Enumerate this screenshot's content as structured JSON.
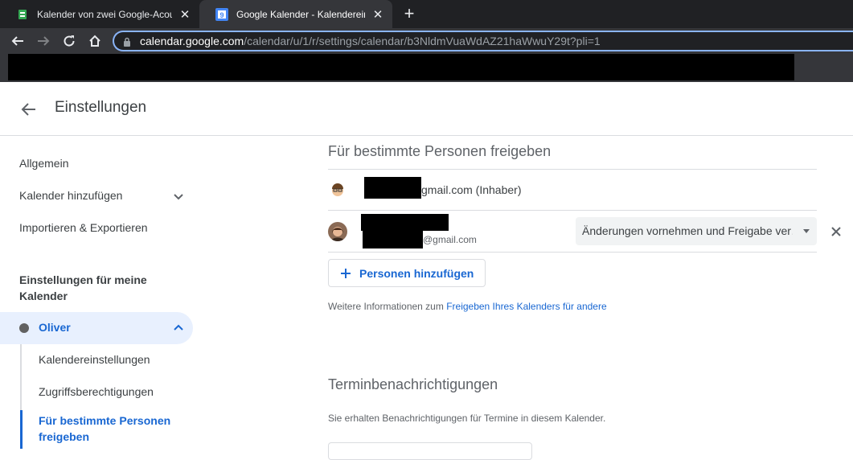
{
  "browser": {
    "tabs": [
      {
        "title": "Kalender von zwei Google-Acoun",
        "active": false,
        "favicon": "green-calendar-favicon"
      },
      {
        "title": "Google Kalender - Kalendereinste",
        "active": true,
        "favicon": "google-calendar-favicon"
      }
    ],
    "url_host": "calendar.google.com",
    "url_path": "/calendar/u/1/r/settings/calendar/b3NldmVuaWdAZ21haWwuY29t?pli=1"
  },
  "header": {
    "title": "Einstellungen"
  },
  "sidebar": {
    "items": [
      {
        "label": "Allgemein"
      },
      {
        "label": "Kalender hinzufügen"
      },
      {
        "label": "Importieren & Exportieren"
      }
    ],
    "section_label": "Einstellungen für meine Kalender",
    "calendar": {
      "name": "Oliver",
      "color": "#616161"
    },
    "sub_items": [
      {
        "label": "Kalendereinstellungen"
      },
      {
        "label": "Zugriffsberechtigungen"
      },
      {
        "label": "Für bestimmte Personen freigeben"
      }
    ]
  },
  "sharing": {
    "heading": "Für bestimmte Personen freigeben",
    "people": [
      {
        "email_suffix": "gmail.com (Inhaber)"
      },
      {
        "email_suffix": "@gmail.com",
        "permission": "Änderungen vornehmen und Freigabe ver…"
      }
    ],
    "add_button": "Personen hinzufügen",
    "info_text": "Weitere Informationen zum",
    "info_link": "Freigeben Ihres Kalenders für andere"
  },
  "notifications": {
    "heading": "Terminbenachrichtigungen",
    "description": "Sie erhalten Benachrichtigungen für Termine in diesem Kalender."
  },
  "colors": {
    "accent": "#1967d2",
    "selected_bg": "#e8f0fe",
    "chrome_dark": "#202124",
    "chrome_mid": "#35363a"
  }
}
